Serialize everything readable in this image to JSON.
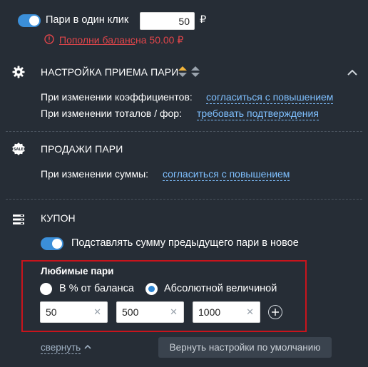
{
  "one_click": {
    "label": "Пари в один клик",
    "amount": "50",
    "currency": "₽",
    "warning_link": "Пополни баланс",
    "warning_rest": "на 50.00 ₽"
  },
  "bet_settings": {
    "title": "НАСТРОЙКА ПРИЕМА ПАРИ",
    "odds_label": "При изменении коэффициентов:",
    "odds_value": "согласиться с повышением",
    "totals_label": "При изменении тоталов / фор:",
    "totals_value": "требовать подтверждения"
  },
  "sales": {
    "title": "ПРОДАЖИ ПАРИ",
    "sum_label": "При изменении суммы:",
    "sum_value": "согласиться с повышением"
  },
  "coupon": {
    "title": "КУПОН",
    "prev_sum_label": "Подставлять сумму предыдущего пари в новое",
    "favorites_title": "Любимые пари",
    "radio_percent": "В % от баланса",
    "radio_absolute": "Абсолютной величиной",
    "amounts": [
      "50",
      "500",
      "1000"
    ]
  },
  "footer": {
    "collapse": "свернуть",
    "reset": "Вернуть настройки по умолчанию"
  },
  "colors": {
    "background": "#262d36",
    "accent": "#3b8fd9",
    "link": "#7fc0ff",
    "warning": "#e0454a",
    "highlight_border": "#c8141c"
  }
}
